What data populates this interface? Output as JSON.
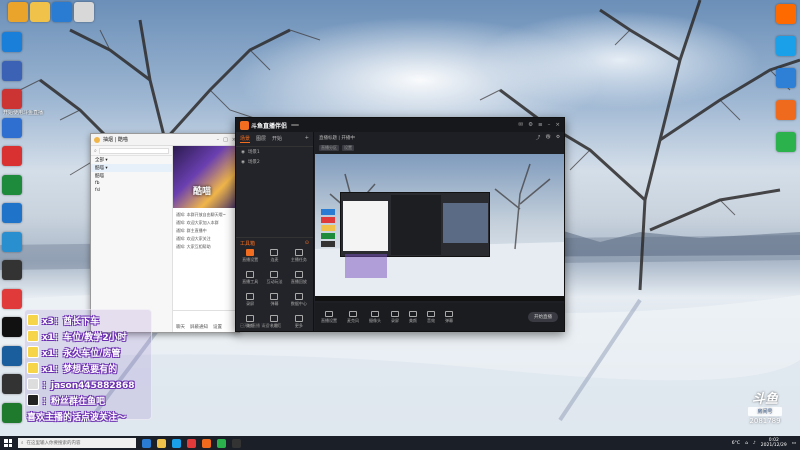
{
  "desktop": {
    "left_icons": [
      {
        "label": "",
        "color": "#1a7fd8"
      },
      {
        "label": "",
        "color": "#3b62b5"
      },
      {
        "label": "开始使用斗鱼直播",
        "color": "#c33"
      },
      {
        "label": "",
        "color": "#2f6fd0"
      },
      {
        "label": "",
        "color": "#d93131"
      },
      {
        "label": "",
        "color": "#1e8a3c"
      },
      {
        "label": "",
        "color": "#1f74c9"
      },
      {
        "label": "",
        "color": "#2a8fcf"
      },
      {
        "label": "",
        "color": "#333"
      },
      {
        "label": "",
        "color": "#e03a3a"
      },
      {
        "label": "",
        "color": "#111"
      },
      {
        "label": "",
        "color": "#1b5e9e"
      },
      {
        "label": "",
        "color": "#333"
      },
      {
        "label": "",
        "color": "#1f7a2e"
      }
    ],
    "top_icons": [
      {
        "color": "#eaa32b"
      },
      {
        "color": "#f0c24a"
      },
      {
        "color": "#2a7cd2"
      },
      {
        "color": "#d8d8d8"
      }
    ],
    "right_icons": [
      {
        "label": "",
        "color": "#ff6a00"
      },
      {
        "label": "",
        "color": "#1aa0e8"
      },
      {
        "label": "",
        "color": "#2d80d6"
      },
      {
        "label": "",
        "color": "#f06a1e"
      },
      {
        "label": "",
        "color": "#2bb24c"
      }
    ]
  },
  "qq_window": {
    "title": "抽烟 | 酷喵",
    "search_placeholder": "",
    "tree": [
      "全部 ▾",
      "酷喵 ▾",
      "酷喵",
      "fb",
      "fsl"
    ],
    "banner_text": "酷喵",
    "chat_lines": [
      "通知: 本群开放自由聊天哦~",
      "通知: 欢迎大家加入本群",
      "通知: 群主直播中",
      "通知: 欢迎大家关注",
      "通知: 大家互相帮助"
    ],
    "footer_actions": [
      "聊天",
      "屏蔽通知",
      "设置"
    ]
  },
  "stream_app": {
    "title": "斗鱼直播伴侣",
    "version_pill": "",
    "tabs": [
      "场景",
      "图层",
      "开始"
    ],
    "active_tab": "场景",
    "scenes": [
      "场景1",
      "场景2"
    ],
    "room_title": "直播标题 | 开播中",
    "room_meta": [
      "直播分区",
      "设置"
    ],
    "tools_header": "工具箱",
    "tools": [
      {
        "label": "直播设置",
        "hot": true
      },
      {
        "label": "连麦",
        "hot": false
      },
      {
        "label": "主播任务",
        "hot": false
      },
      {
        "label": "直播工具",
        "hot": false
      },
      {
        "label": "互动玩法",
        "hot": false
      },
      {
        "label": "直播回放",
        "hot": false
      },
      {
        "label": "录屏",
        "hot": false
      },
      {
        "label": "弹幕",
        "hot": false
      },
      {
        "label": "数据中心",
        "hot": false
      },
      {
        "label": "美颜",
        "hot": false
      },
      {
        "label": "礼物",
        "hot": false
      },
      {
        "label": "更多",
        "hot": false
      }
    ],
    "bottom_note": "已开启直播 请遵守规范",
    "controls": [
      "直播设置",
      "麦克风",
      "摄像头",
      "录屏",
      "美颜",
      "音效",
      "弹幕"
    ],
    "go_live": "开始直播"
  },
  "overlay_chat": [
    {
      "text": "x3：酋长下车",
      "badge": "gold"
    },
    {
      "text": "x1：车位/教学2小时",
      "badge": "gold"
    },
    {
      "text": "x1：永久车位/房管",
      "badge": "gold"
    },
    {
      "text": "x1：梦想总要有的",
      "badge": "gold"
    },
    {
      "text": "：jason445882868",
      "badge": "gray"
    },
    {
      "text": "：粉丝群在鱼吧",
      "badge": "dark"
    },
    {
      "text": "喜欢主播的话点波关注～",
      "badge": "none"
    }
  ],
  "watermark": {
    "logo": "斗鱼",
    "sub": "房间号",
    "room_id": "2081789"
  },
  "taskbar": {
    "search_placeholder": "在这里输入你要搜索的内容",
    "pinned": [
      "#2a7cd2",
      "#f0c24a",
      "#1aa0e8",
      "#e03a3a",
      "#f06a1e",
      "#2bb24c",
      "#333"
    ],
    "tray_temp": "6°C",
    "time": "0:02",
    "date": "2021/12/29"
  }
}
